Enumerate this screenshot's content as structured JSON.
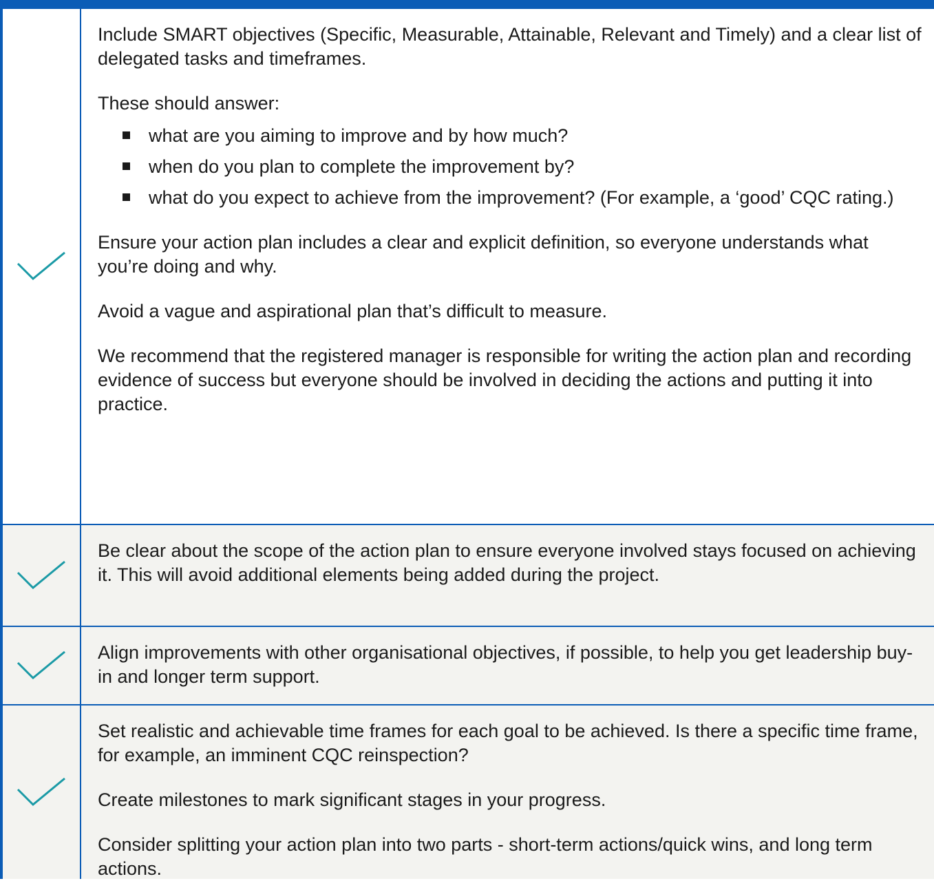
{
  "colors": {
    "accent": "#0b5cb6",
    "check": "#1a9aa6",
    "row_shade": "#f3f3f0"
  },
  "icon": "checkmark-icon",
  "rows": [
    {
      "p1": "Include SMART objectives (Specific, Measurable, Attainable, Relevant and Timely) and a clear list of delegated tasks and timeframes.",
      "p2": "These should answer:",
      "bullets": [
        "what are you aiming to improve and by how much?",
        "when do you plan to complete the improvement by?",
        "what do you expect to achieve from the improvement? (For example, a ‘good’ CQC rating.)"
      ],
      "p3": "Ensure your action plan includes a clear and explicit definition, so everyone understands what you’re doing and why.",
      "p4": "Avoid a vague and aspirational plan that’s difficult to measure.",
      "p5": "We recommend that the registered manager is responsible for writing the action plan and recording evidence of success but everyone should be involved in deciding the actions and putting it into practice."
    },
    {
      "p1": "Be clear about the scope of the action plan to ensure everyone involved stays focused on achieving it. This will avoid additional elements being added during the project."
    },
    {
      "p1": "Align improvements with other organisational objectives, if possible, to help you get leadership buy-in and longer term support."
    },
    {
      "p1": "Set realistic and achievable time frames for each goal to be achieved. Is there a specific time frame, for example, an imminent CQC reinspection?",
      "p2": "Create milestones to mark significant stages in your progress.",
      "p3": "Consider splitting your action plan into two parts - short-term actions/quick wins, and long term actions."
    }
  ]
}
